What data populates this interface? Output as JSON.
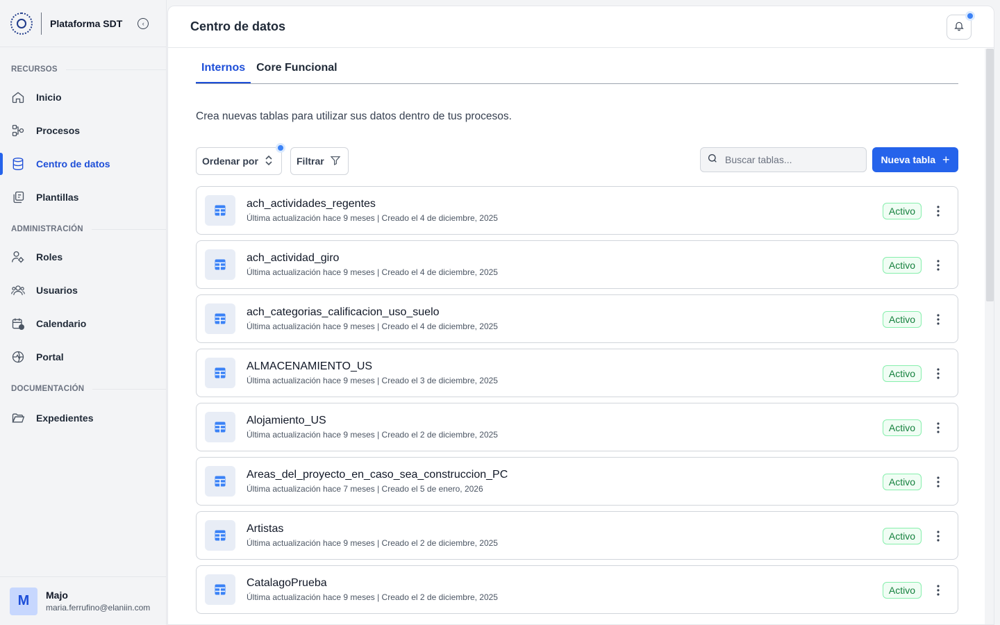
{
  "brand": {
    "name": "Plataforma SDT"
  },
  "sidebar": {
    "sections": {
      "recursos": "RECURSOS",
      "administracion": "ADMINISTRACIÓN",
      "documentacion": "DOCUMENTACIÓN"
    },
    "items": [
      {
        "label": "Inicio",
        "icon": "home-icon"
      },
      {
        "label": "Procesos",
        "icon": "flow-icon"
      },
      {
        "label": "Centro de datos",
        "icon": "database-icon",
        "active": true
      },
      {
        "label": "Plantillas",
        "icon": "templates-icon"
      },
      {
        "label": "Roles",
        "icon": "user-roles-icon"
      },
      {
        "label": "Usuarios",
        "icon": "users-icon"
      },
      {
        "label": "Calendario",
        "icon": "calendar-icon"
      },
      {
        "label": "Portal",
        "icon": "portal-icon"
      },
      {
        "label": "Expedientes",
        "icon": "folder-icon"
      }
    ]
  },
  "user": {
    "initial": "M",
    "name": "Majo",
    "email": "maria.ferrufino@elaniin.com"
  },
  "header": {
    "title": "Centro de datos"
  },
  "tabs": [
    {
      "label": "Internos",
      "active": true
    },
    {
      "label": "Core Funcional",
      "active": false
    }
  ],
  "description": "Crea nuevas tablas para utilizar sus datos dentro de tus procesos.",
  "toolbar": {
    "order_label": "Ordenar por",
    "filter_label": "Filtrar",
    "search_placeholder": "Buscar tablas...",
    "new_table_label": "Nueva tabla"
  },
  "colors": {
    "accent": "#2563eb",
    "active_badge": "#15803d"
  },
  "tables": [
    {
      "name": "ach_actividades_regentes",
      "meta": "Última actualización hace 9 meses | Creado el 4 de diciembre, 2025",
      "status": "Activo"
    },
    {
      "name": "ach_actividad_giro",
      "meta": "Última actualización hace 9 meses | Creado el 4 de diciembre, 2025",
      "status": "Activo"
    },
    {
      "name": "ach_categorias_calificacion_uso_suelo",
      "meta": "Última actualización hace 9 meses | Creado el 4 de diciembre, 2025",
      "status": "Activo"
    },
    {
      "name": "ALMACENAMIENTO_US",
      "meta": "Última actualización hace 9 meses | Creado el 3 de diciembre, 2025",
      "status": "Activo"
    },
    {
      "name": "Alojamiento_US",
      "meta": "Última actualización hace 9 meses | Creado el 2 de diciembre, 2025",
      "status": "Activo"
    },
    {
      "name": "Areas_del_proyecto_en_caso_sea_construccion_PC",
      "meta": "Última actualización hace 7 meses | Creado el 5 de enero, 2026",
      "status": "Activo"
    },
    {
      "name": "Artistas",
      "meta": "Última actualización hace 9 meses | Creado el 2 de diciembre, 2025",
      "status": "Activo"
    },
    {
      "name": "CatalagoPrueba",
      "meta": "Última actualización hace 9 meses | Creado el 2 de diciembre, 2025",
      "status": "Activo"
    }
  ]
}
